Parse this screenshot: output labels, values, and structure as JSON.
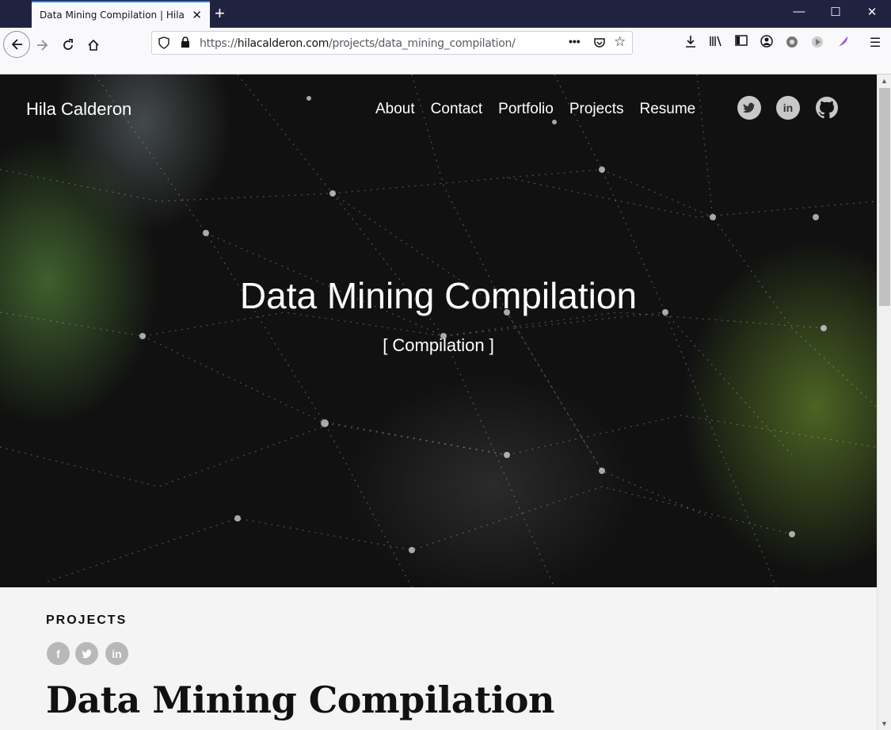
{
  "browser": {
    "tab_title": "Data Mining Compilation | Hila Calderon",
    "url_prefix": "https://",
    "url_domain": "hilacalderon.com",
    "url_path": "/projects/data_mining_compilation/"
  },
  "site": {
    "brand": "Hila Calderon",
    "nav": [
      "About",
      "Contact",
      "Portfolio",
      "Projects",
      "Resume"
    ],
    "social": [
      "twitter-icon",
      "linkedin-icon",
      "github-icon"
    ]
  },
  "hero": {
    "title": "Data Mining Compilation",
    "subtitle": "[ Compilation ]"
  },
  "content": {
    "section_label": "PROJECTS",
    "share_icons": [
      "facebook-icon",
      "twitter-icon",
      "linkedin-icon"
    ],
    "post_title": "Data Mining Compilation"
  },
  "colors": {
    "tabbar": "#202340",
    "accent": "#0a84ff",
    "hero_text": "#ffffff"
  }
}
